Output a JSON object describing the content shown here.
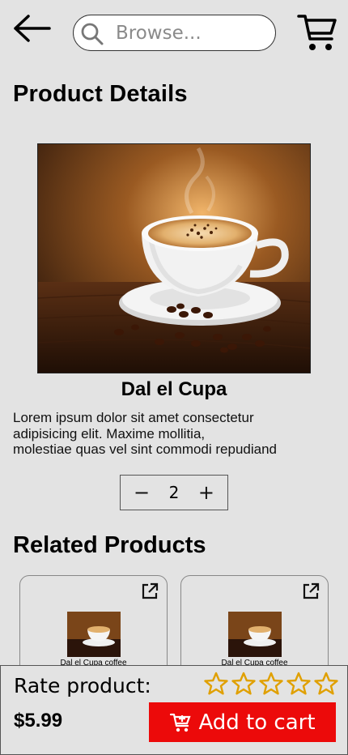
{
  "header": {
    "search_placeholder": "Browse...",
    "back_icon": "arrow-left-icon",
    "cart_icon": "shopping-cart-icon",
    "search_icon": "search-icon"
  },
  "page_title": "Product Details",
  "product": {
    "name": "Dal el Cupa",
    "description_lines": [
      "Lorem ipsum dolor sit amet consectetur",
      "adipisicing elit. Maxime mollitia,",
      "molestiae quas vel sint commodi repudiand"
    ],
    "quantity": "2",
    "decrement_label": "−",
    "increment_label": "+"
  },
  "related": {
    "title": "Related Products",
    "items": [
      {
        "name": "Dal el Cupa coffee",
        "icon": "open-external-icon"
      },
      {
        "name": "Dal el Cupa coffee",
        "icon": "open-external-icon"
      }
    ]
  },
  "footer": {
    "rate_label": "Rate product:",
    "star_count": 5,
    "rating": 0,
    "price": "$5.99",
    "add_to_cart_label": "Add to cart",
    "add_to_cart_icon": "cart-add-icon",
    "colors": {
      "button": "#ec0a0a",
      "star": "#e0a000"
    }
  }
}
